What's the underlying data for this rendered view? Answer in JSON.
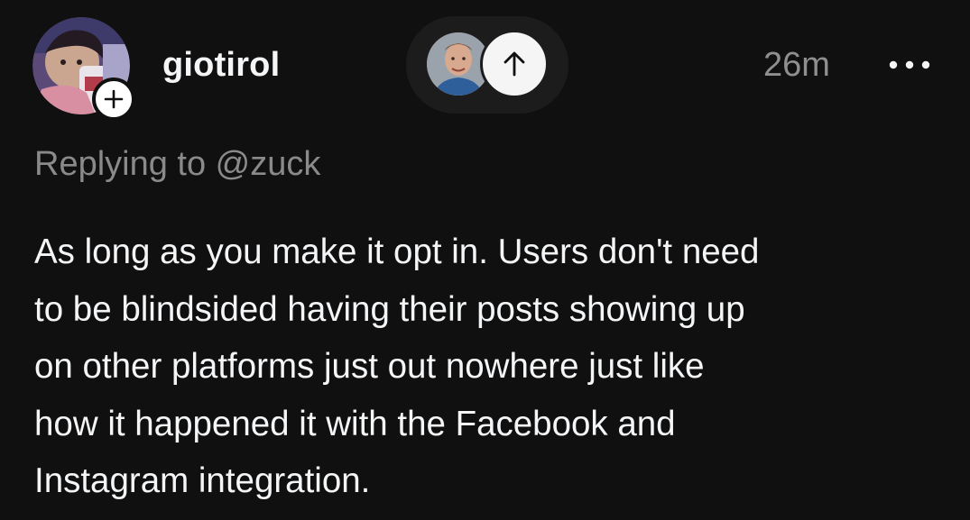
{
  "post": {
    "author": {
      "username": "giotirol",
      "avatar_icon": "user-avatar-photo",
      "follow_icon": "plus-icon"
    },
    "reply_indicator": {
      "avatar_icon": "replied-user-avatar-photo",
      "arrow_icon": "arrow-up-icon"
    },
    "timestamp": "26m",
    "more_icon": "ellipsis-icon",
    "replying_to": "Replying to @zuck",
    "text": "As long as you make it opt in. Users don't need\nto be blindsided having their posts showing up\non other platforms just out nowhere just like\nhow it happened it with the Facebook and\nInstagram integration."
  },
  "colors": {
    "background": "#101010",
    "primary_text": "#f3f5f7",
    "secondary_text": "#8f8f8f",
    "pill_background": "#1c1c1c"
  }
}
